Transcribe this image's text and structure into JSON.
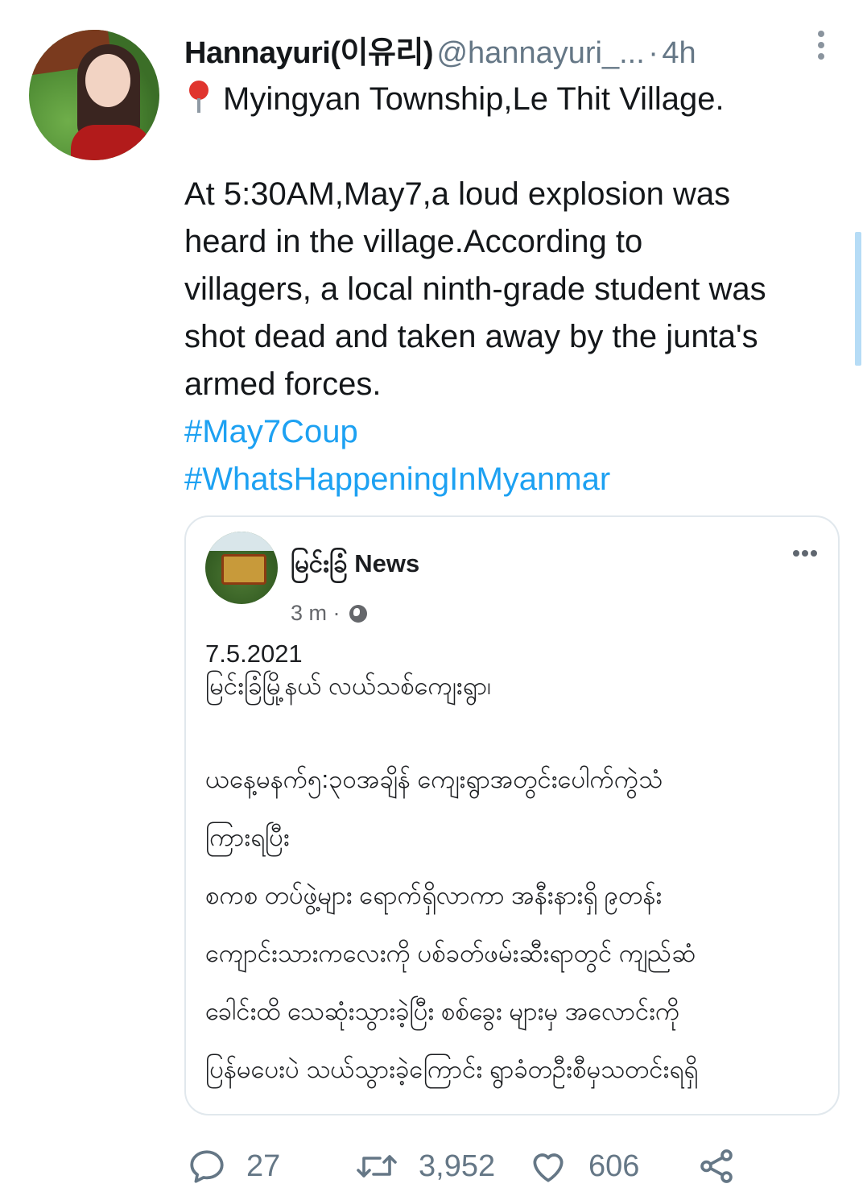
{
  "tweet": {
    "display_name": "Hannayuri(이유리)",
    "handle": "@hannayuri_...",
    "separator": "·",
    "time": "4h",
    "location_line": "Myingyan Township,Le Thit Village.",
    "body_lines": [
      "At 5:30AM,May7,a loud explosion was",
      "heard in the village.According to",
      "villagers, a local ninth-grade student was",
      "shot dead and taken away by the junta's",
      "armed forces."
    ],
    "hashtags": [
      "#May7Coup",
      "#WhatsHappeningInMyanmar"
    ]
  },
  "embedded_post": {
    "page_name": "မြင်းခြံ News",
    "time": "3 m ·",
    "lines": [
      "7.5.2021",
      "မြင်းခြံမြို့နယ် လယ်သစ်ကျေးရွာ၊",
      "ယနေ့မနက်၅:၃၀အချိန် ကျေးရွာအတွင်းပေါက်ကွဲသံ",
      "ကြားရပြီး",
      "စကစ တပ်ဖွဲ့များ ရောက်ရှိလာကာ အနီးနားရှိ ၉တန်း",
      "ကျောင်းသားကလေးကို ပစ်ခတ်ဖမ်းဆီးရာတွင် ကျည်ဆံ",
      "ခေါင်းထိ သေဆုံးသွားခဲ့ပြီး စစ်ခွေး များမှ အလောင်းကို",
      "ပြန်မပေးပဲ သယ်သွားခဲ့ကြောင်း ရွာခံတဦးစီမှသတင်းရရှိ"
    ]
  },
  "actions": {
    "reply_count": "27",
    "retweet_count": "3,952",
    "like_count": "606"
  },
  "colors": {
    "link": "#1da1f2",
    "muted": "#657786",
    "scrollbar": "#b6dcf6"
  },
  "icons": [
    "map-pin-icon",
    "more-vertical-icon",
    "more-horizontal-icon",
    "globe-icon",
    "reply-icon",
    "retweet-icon",
    "like-icon",
    "share-icon"
  ]
}
